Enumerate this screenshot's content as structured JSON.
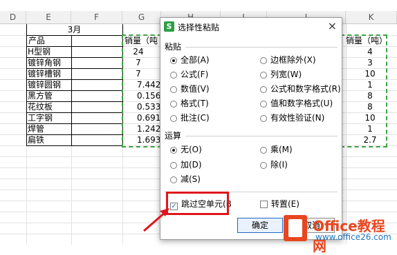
{
  "columns": [
    "D",
    "E",
    "F",
    "G",
    "H",
    "I",
    "J",
    "K"
  ],
  "month_header": "3月",
  "product_header": "产品",
  "products": [
    "H型钢",
    "镀锌角钢",
    "镀锌槽钢",
    "镀锌圆钢",
    "黑方管",
    "花纹板",
    "工字钢",
    "焊管",
    "扁铁"
  ],
  "sales_header_left": "销量（吨",
  "sales_values_left": [
    "24",
    "7",
    "7",
    "7.442",
    "0.156",
    "0.533",
    "0.691",
    "1.242",
    "1.693"
  ],
  "sales_header_right": "销量（吨）",
  "sales_values_right": [
    "4",
    "3",
    "10",
    "1",
    "8",
    "8",
    "10",
    "1",
    "2.7"
  ],
  "dialog": {
    "title": "选择性粘贴",
    "app_icon": "S",
    "close_icon": "×",
    "paste_section": "粘贴",
    "paste_options_left": [
      {
        "label": "全部(A)",
        "selected": true
      },
      {
        "label": "公式(F)",
        "selected": false
      },
      {
        "label": "数值(V)",
        "selected": false
      },
      {
        "label": "格式(T)",
        "selected": false
      },
      {
        "label": "批注(C)",
        "selected": false
      }
    ],
    "paste_options_right": [
      {
        "label": "边框除外(X)",
        "selected": false
      },
      {
        "label": "列宽(W)",
        "selected": false
      },
      {
        "label": "公式和数字格式(R)",
        "selected": false
      },
      {
        "label": "值和数字格式(U)",
        "selected": false
      },
      {
        "label": "有效性验证(N)",
        "selected": false
      }
    ],
    "operation_section": "运算",
    "operation_options_left": [
      {
        "label": "无(O)",
        "selected": true
      },
      {
        "label": "加(D)",
        "selected": false
      },
      {
        "label": "减(S)",
        "selected": false
      }
    ],
    "operation_options_right": [
      {
        "label": "乘(M)",
        "selected": false
      },
      {
        "label": "除(I)",
        "selected": false
      }
    ],
    "skip_blanks": {
      "label": "跳过空单元(B",
      "checked": true
    },
    "transpose": {
      "label": "转置(E)",
      "checked": false
    },
    "ok_label": "确定",
    "cancel_label": "取消"
  },
  "watermark": {
    "title": "Office教程网",
    "url": "www.office26.com"
  },
  "colors": {
    "highlight": "#e0141a",
    "dash": "#3aa340",
    "watermark": "#e8461f"
  }
}
